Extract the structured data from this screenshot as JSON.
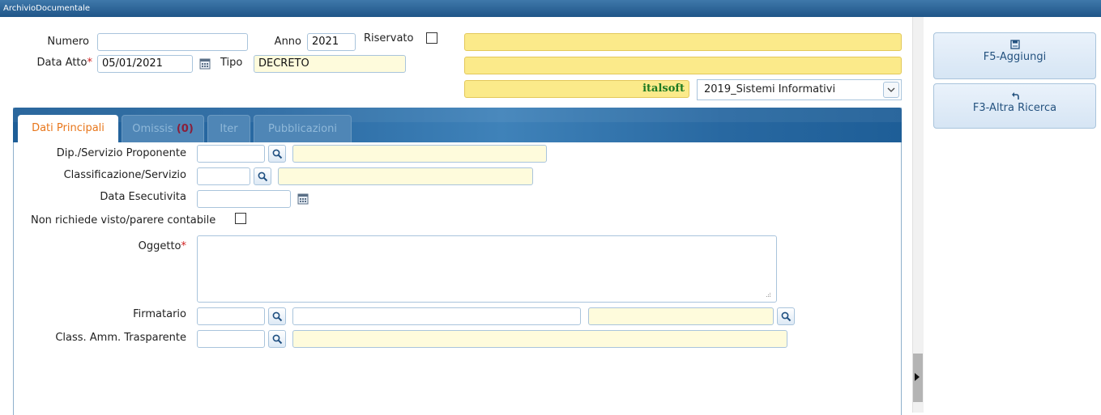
{
  "window": {
    "title": "ArchivioDocumentale"
  },
  "header": {
    "numero_label": "Numero",
    "numero_value": "",
    "anno_label": "Anno",
    "anno_value": "2021",
    "riservato_label": "Riservato",
    "data_atto_label": "Data Atto",
    "data_atto_value": "05/01/2021",
    "tipo_label": "Tipo",
    "tipo_value": "DECRETO",
    "info_line1": "",
    "info_line2": "",
    "info_line3": "italsoft",
    "servizio_select_value": "2019_Sistemi Informativi"
  },
  "tabs": [
    {
      "label": "Dati Principali"
    },
    {
      "label": "Omissis",
      "count": "(0)"
    },
    {
      "label": "Iter"
    },
    {
      "label": "Pubblicazioni"
    }
  ],
  "form": {
    "dip_servizio_label": "Dip./Servizio Proponente",
    "classificazione_label": "Classificazione/Servizio",
    "data_esecutivita_label": "Data Esecutivita",
    "non_richiede_label": "Non richiede visto/parere contabile",
    "oggetto_label": "Oggetto",
    "firmatario_label": "Firmatario",
    "class_amm_label": "Class. Amm. Trasparente"
  },
  "sidebar": {
    "aggiungi_label": "F5-Aggiungi",
    "altra_ricerca_label": "F3-Altra Ricerca"
  },
  "required_marker": "*",
  "icons": {
    "calendar": "calendar-icon",
    "search": "search-icon",
    "save": "floppy-disk-icon",
    "back": "return-arrow-icon"
  },
  "colors": {
    "titlebar": "#2a62a0",
    "tab_band": "#2a6aa3",
    "active_tab_text": "#e8761a",
    "readonly_field": "#fefbdc",
    "highlight_field": "#fbea8a",
    "sidebar_button_text": "#24527f",
    "required": "#d02020"
  }
}
